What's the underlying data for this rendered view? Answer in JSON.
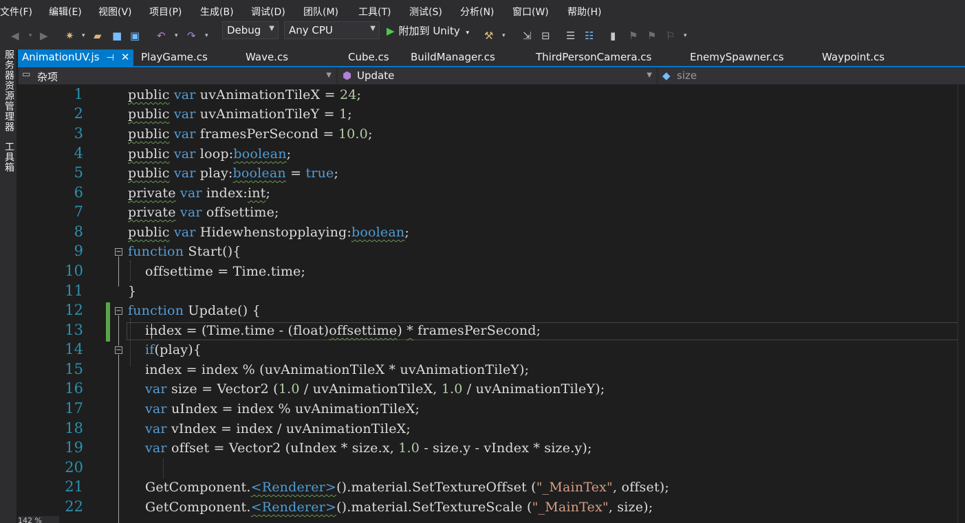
{
  "menu": [
    "文件(F)",
    "编辑(E)",
    "视图(V)",
    "项目(P)",
    "生成(B)",
    "调试(D)",
    "团队(M)",
    "工具(T)",
    "测试(S)",
    "分析(N)",
    "窗口(W)",
    "帮助(H)"
  ],
  "toolbar": {
    "config": "Debug",
    "platform": "Any CPU",
    "attach_label": "附加到 Unity"
  },
  "sidebar": {
    "server_explorer": "服务器资源管理器",
    "toolbox": "工具箱"
  },
  "tabs": [
    {
      "label": "AnimationUV.js",
      "active": true
    },
    {
      "label": "PlayGame.cs"
    },
    {
      "label": "Wave.cs"
    },
    {
      "label": "Cube.cs"
    },
    {
      "label": "BuildManager.cs"
    },
    {
      "label": "ThirdPersonCamera.cs"
    },
    {
      "label": "EnemySpawner.cs"
    },
    {
      "label": "Waypoint.cs"
    }
  ],
  "navbar": {
    "scope": "杂项",
    "member": "Update",
    "symbol": "size"
  },
  "zoom": "142 %",
  "line_numbers": [
    "1",
    "2",
    "3",
    "4",
    "5",
    "6",
    "7",
    "8",
    "9",
    "10",
    "11",
    "12",
    "13",
    "14",
    "15",
    "16",
    "17",
    "18",
    "19",
    "20",
    "21",
    "22"
  ],
  "colors": {
    "accent": "#007acc",
    "keyword": "#569cd6",
    "line_number": "#2b91af",
    "change_bar": "#57a64a",
    "background": "#1e1e1e"
  }
}
